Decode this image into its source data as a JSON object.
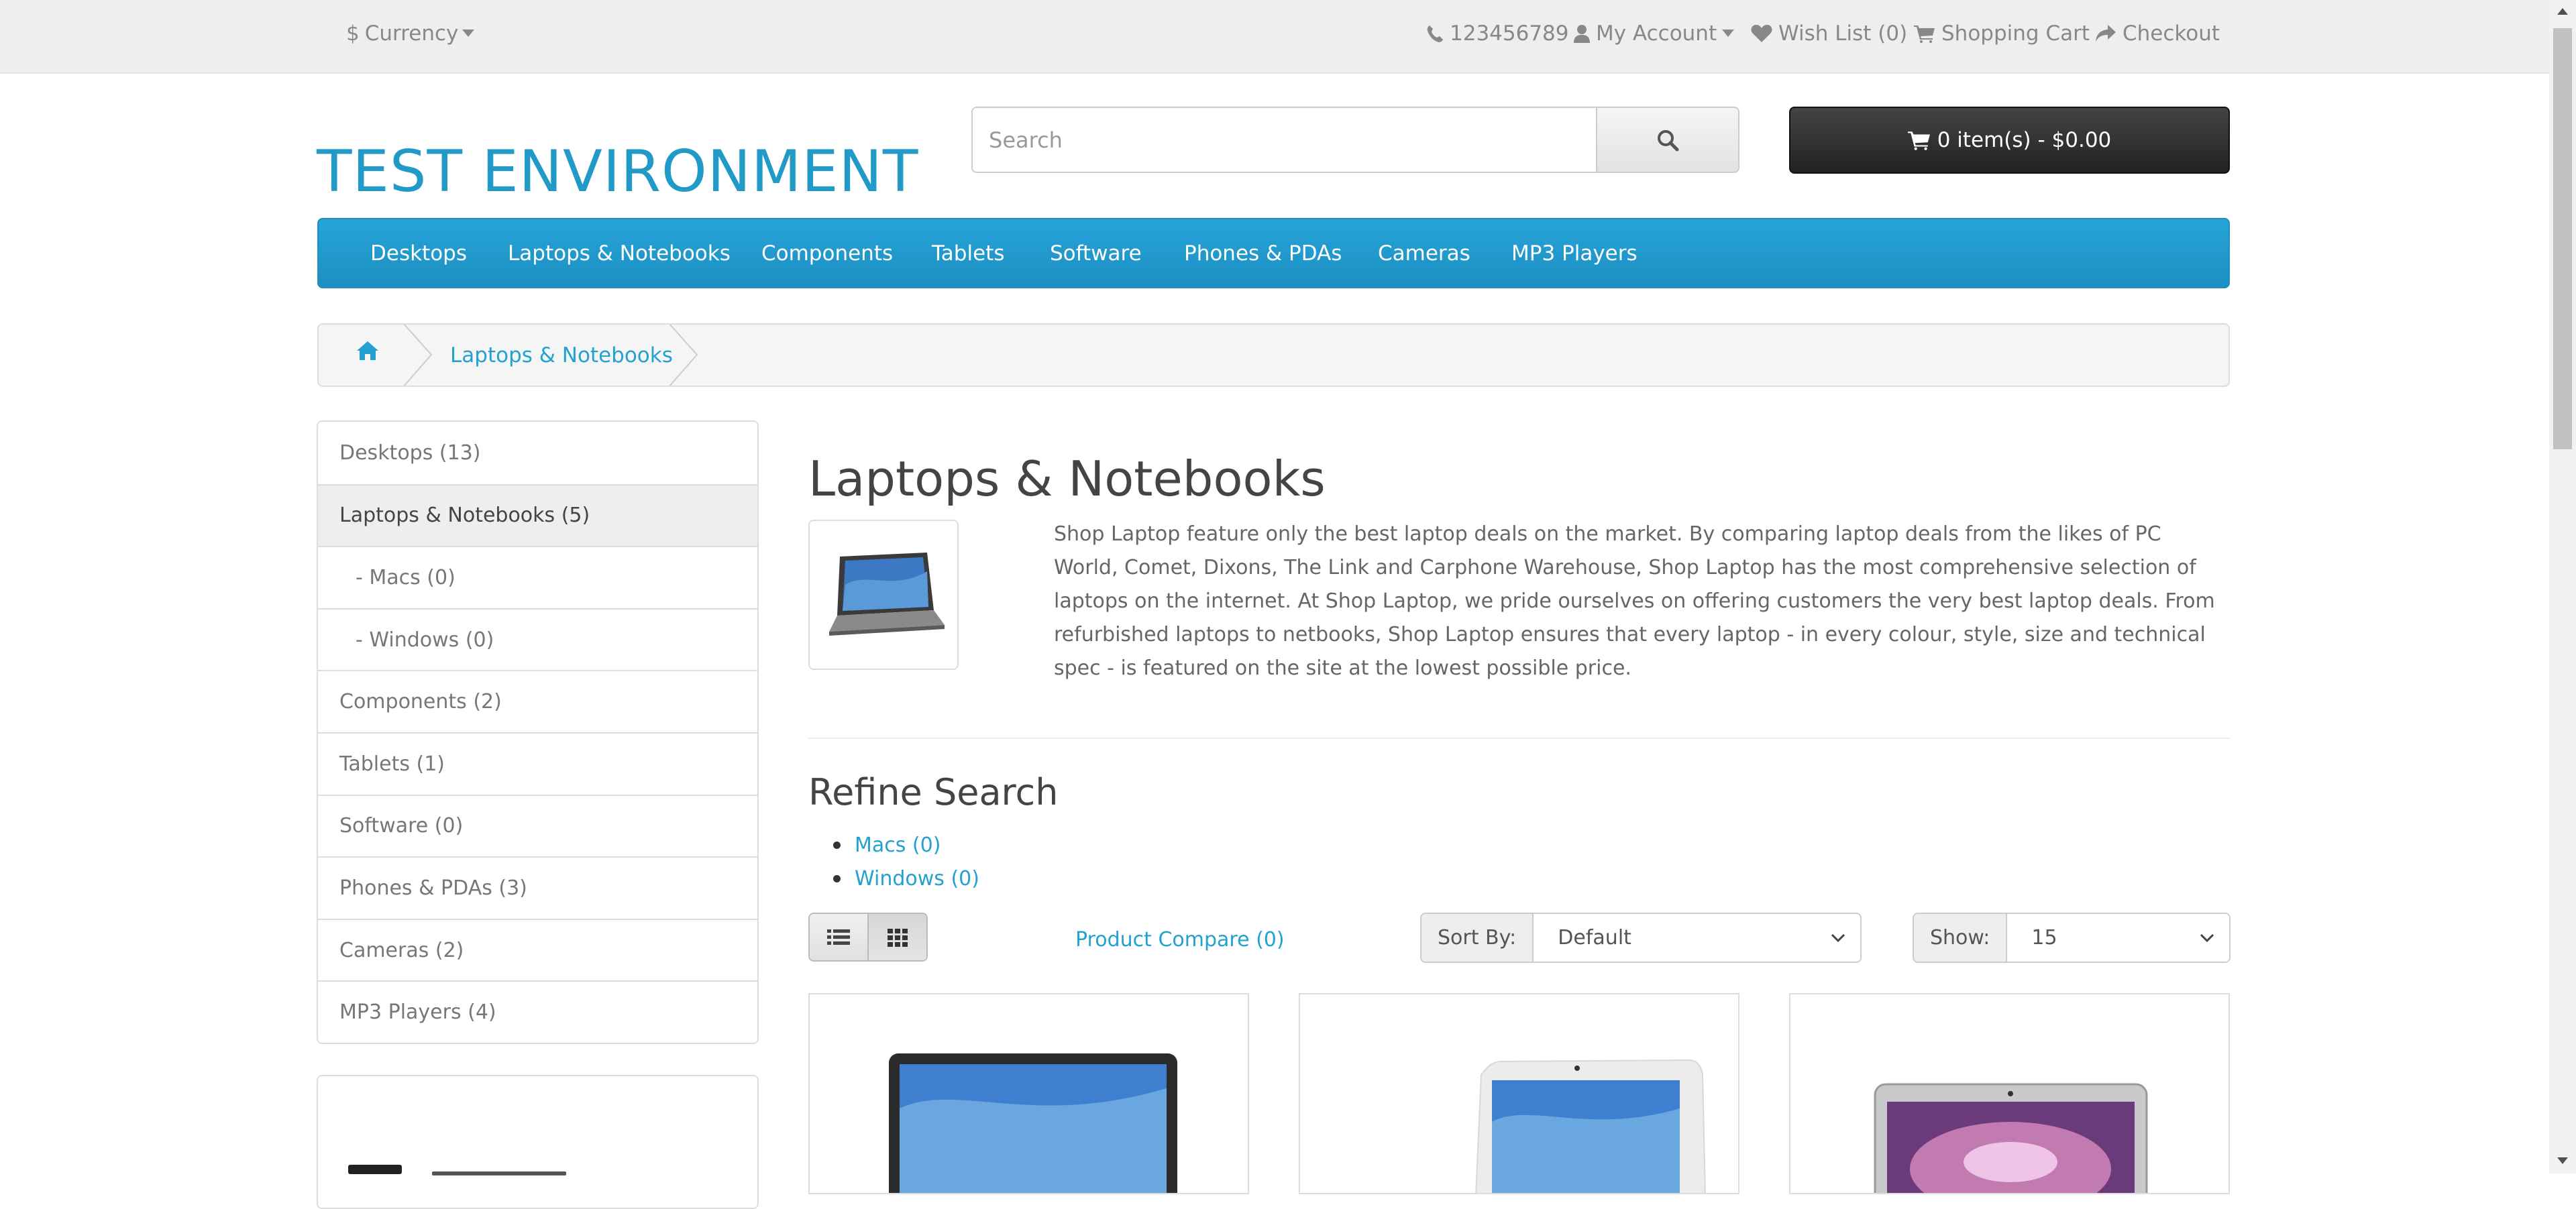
{
  "topbar": {
    "currency": "Currency",
    "phone": "123456789",
    "my_account": "My Account",
    "wish_list": "Wish List (0)",
    "shopping_cart": "Shopping Cart",
    "checkout": "Checkout"
  },
  "header": {
    "logo": "TEST ENVIRONMENT",
    "search_placeholder": "Search",
    "cart_button": "0 item(s) - $0.00"
  },
  "menu": {
    "items": [
      "Desktops",
      "Laptops & Notebooks",
      "Components",
      "Tablets",
      "Software",
      "Phones & PDAs",
      "Cameras",
      "MP3 Players"
    ]
  },
  "breadcrumb": {
    "current": "Laptops & Notebooks"
  },
  "sidebar": {
    "categories": [
      {
        "label": "Desktops (13)",
        "active": false,
        "sub": false
      },
      {
        "label": "Laptops & Notebooks (5)",
        "active": true,
        "sub": false
      },
      {
        "label": "- Macs (0)",
        "active": false,
        "sub": true
      },
      {
        "label": "- Windows (0)",
        "active": false,
        "sub": true
      },
      {
        "label": "Components (2)",
        "active": false,
        "sub": false
      },
      {
        "label": "Tablets (1)",
        "active": false,
        "sub": false
      },
      {
        "label": "Software (0)",
        "active": false,
        "sub": false
      },
      {
        "label": "Phones & PDAs (3)",
        "active": false,
        "sub": false
      },
      {
        "label": "Cameras (2)",
        "active": false,
        "sub": false
      },
      {
        "label": "MP3 Players (4)",
        "active": false,
        "sub": false
      }
    ]
  },
  "content": {
    "title": "Laptops & Notebooks",
    "description": "Shop Laptop feature only the best laptop deals on the market. By comparing laptop deals from the likes of PC World, Comet, Dixons, The Link and Carphone Warehouse, Shop Laptop has the most comprehensive selection of laptops on the internet. At Shop Laptop, we pride ourselves on offering customers the very best laptop deals. From refurbished laptops to netbooks, Shop Laptop ensures that every laptop - in every colour, style, size and technical spec - is featured on the site at the lowest possible price.",
    "refine_title": "Refine Search",
    "refine_links": [
      "Macs (0)",
      "Windows (0)"
    ],
    "product_compare": "Product Compare (0)",
    "sort_label": "Sort By:",
    "sort_value": "Default",
    "show_label": "Show:",
    "show_value": "15"
  },
  "colors": {
    "brand_blue": "#229ac8",
    "link": "#23a1d1",
    "menu_bg": "#229ac8",
    "cart_bg": "#363636"
  }
}
